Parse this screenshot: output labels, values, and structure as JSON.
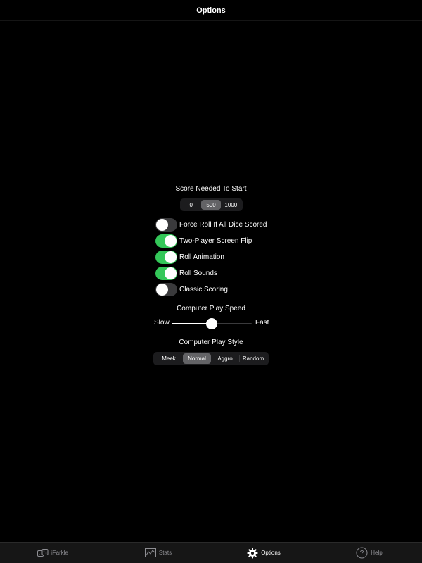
{
  "nav": {
    "title": "Options"
  },
  "score": {
    "label": "Score Needed To Start",
    "options": [
      "0",
      "500",
      "1000"
    ],
    "selected": "500"
  },
  "toggles": [
    {
      "label": "Force Roll If All Dice Scored",
      "on": false
    },
    {
      "label": "Two-Player Screen Flip",
      "on": true
    },
    {
      "label": "Roll Animation",
      "on": true
    },
    {
      "label": "Roll Sounds",
      "on": true
    },
    {
      "label": "Classic Scoring",
      "on": false
    }
  ],
  "speed": {
    "label": "Computer Play Speed",
    "min_label": "Slow",
    "max_label": "Fast",
    "value": 0.5
  },
  "style": {
    "label": "Computer Play Style",
    "options": [
      "Meek",
      "Normal",
      "Aggro",
      "Random"
    ],
    "selected": "Normal"
  },
  "tabs": [
    {
      "label": "iFarkle",
      "icon": "dice-icon",
      "active": false
    },
    {
      "label": "Stats",
      "icon": "chart-icon",
      "active": false
    },
    {
      "label": "Options",
      "icon": "gear-icon",
      "active": true
    },
    {
      "label": "Help",
      "icon": "help-icon",
      "active": false
    }
  ],
  "colors": {
    "toggle_on": "#34c759",
    "background": "#000000"
  }
}
